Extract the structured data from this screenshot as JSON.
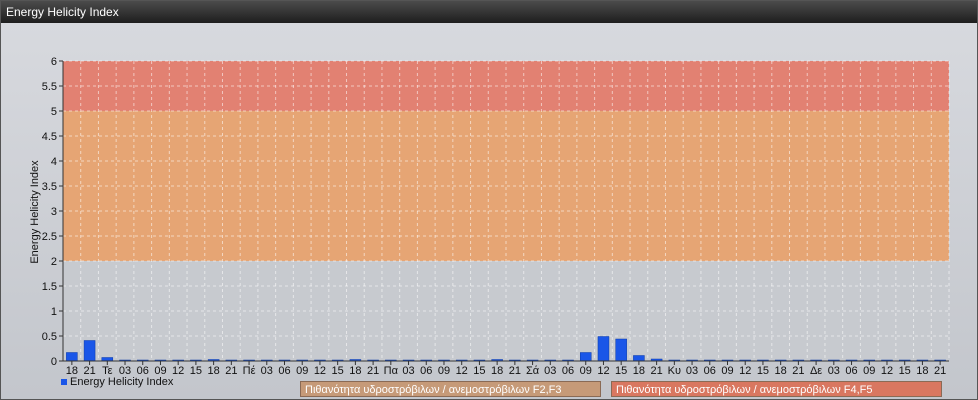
{
  "window": {
    "title": "Energy Helicity Index"
  },
  "colors": {
    "bar": "#1a56e8",
    "band_high": "#e47b6a",
    "band_mid": "#e8a26c",
    "band_f2f3": "#c69a78",
    "band_f4f5": "#d97760"
  },
  "legend": {
    "series_label": "Energy Helicity Index",
    "band1_label": "Πιθανότητα υδροστρόβιλων / ανεμοστρόβιλων F2,F3",
    "band2_label": "Πιθανότητα υδροστρόβιλων / ανεμοστρόβιλων F4,F5"
  },
  "chart_data": {
    "type": "bar",
    "ylabel": "Energy Helicity Index",
    "ylim": [
      0,
      6
    ],
    "yticks": [
      "0",
      "0.5",
      "1",
      "1.5",
      "2",
      "2.5",
      "3",
      "3.5",
      "4",
      "4.5",
      "5",
      "5.5",
      "6"
    ],
    "grid": true,
    "legend_position": "bottom",
    "bands": [
      {
        "from": 2,
        "to": 5,
        "label": "Πιθανότητα υδροστρόβιλων / ανεμοστρόβιλων F2,F3"
      },
      {
        "from": 5,
        "to": 6,
        "label": "Πιθανότητα υδροστρόβιλων / ανεμοστρόβιλων F4,F5"
      }
    ],
    "categories": [
      "18",
      "21",
      "Τε",
      "03",
      "06",
      "09",
      "12",
      "15",
      "18",
      "21",
      "Πέ",
      "03",
      "06",
      "09",
      "12",
      "15",
      "18",
      "21",
      "Πα",
      "03",
      "06",
      "09",
      "12",
      "15",
      "18",
      "21",
      "Σά",
      "03",
      "06",
      "09",
      "12",
      "15",
      "18",
      "21",
      "Κυ",
      "03",
      "06",
      "09",
      "12",
      "15",
      "18",
      "21",
      "Δε",
      "03",
      "06",
      "09",
      "12",
      "15",
      "18",
      "21"
    ],
    "series": [
      {
        "name": "Energy Helicity Index",
        "values": [
          0.17,
          0.41,
          0.07,
          0.02,
          0.02,
          0.02,
          0.02,
          0.02,
          0.03,
          0.02,
          0.02,
          0.02,
          0.02,
          0.02,
          0.02,
          0.02,
          0.03,
          0.02,
          0.02,
          0.02,
          0.02,
          0.02,
          0.02,
          0.02,
          0.03,
          0.02,
          0.02,
          0.02,
          0.02,
          0.17,
          0.49,
          0.44,
          0.11,
          0.04,
          0.02,
          0.02,
          0.02,
          0.02,
          0.02,
          0.02,
          0.02,
          0.02,
          0.02,
          0.02,
          0.02,
          0.02,
          0.02,
          0.02,
          0.02,
          0.02
        ]
      }
    ]
  }
}
